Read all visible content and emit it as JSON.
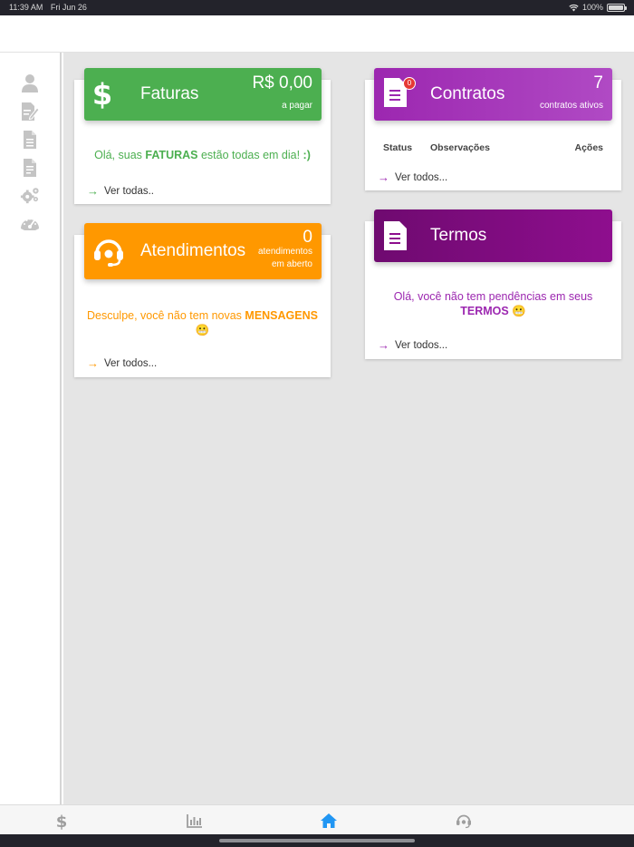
{
  "status_bar": {
    "time": "11:39 AM",
    "date": "Fri Jun 26",
    "battery": "100%"
  },
  "sidebar": {
    "items": [
      {
        "icon": "user-icon"
      },
      {
        "icon": "contract-edit-icon"
      },
      {
        "icon": "document-icon"
      },
      {
        "icon": "document-list-icon"
      },
      {
        "icon": "gears-icon"
      },
      {
        "icon": "speedometer-icon"
      }
    ],
    "icon_color": "#c4c4c4"
  },
  "faturas": {
    "title": "Faturas",
    "amount": "R$ 0,00",
    "amount_label": "a pagar",
    "message_pre": "Olá, suas ",
    "message_bold": "FATURAS",
    "message_post": " estão todas em dia! ",
    "message_smile": ":)",
    "link": "Ver todas..",
    "color": "#4caf50"
  },
  "atendimentos": {
    "title": "Atendimentos",
    "count": "0",
    "count_label_1": "atendimentos",
    "count_label_2": "em aberto",
    "message_pre": "Desculpe, você não tem novas ",
    "message_bold": "MENSAGENS",
    "message_emoji": "😬",
    "link": "Ver todos...",
    "color": "#ff9800"
  },
  "contratos": {
    "title": "Contratos",
    "badge": "0",
    "count": "7",
    "count_label": "contratos ativos",
    "columns": [
      "Status",
      "Observações",
      "Ações"
    ],
    "link": "Ver todos...",
    "color": "#9c27b0"
  },
  "termos": {
    "title": "Termos",
    "message_pre": "Olá, você não tem pendências em seus",
    "message_bold": "TERMOS",
    "message_emoji": "😬",
    "link": "Ver todos...",
    "color": "#8e0e8e"
  },
  "tabbar": {
    "tabs": [
      {
        "icon": "dollar-icon",
        "active": false
      },
      {
        "icon": "bar-chart-icon",
        "active": false
      },
      {
        "icon": "home-icon",
        "active": true
      },
      {
        "icon": "headset-icon",
        "active": false
      }
    ],
    "active_color": "#2196f3",
    "inactive_color": "#9e9e9e"
  }
}
